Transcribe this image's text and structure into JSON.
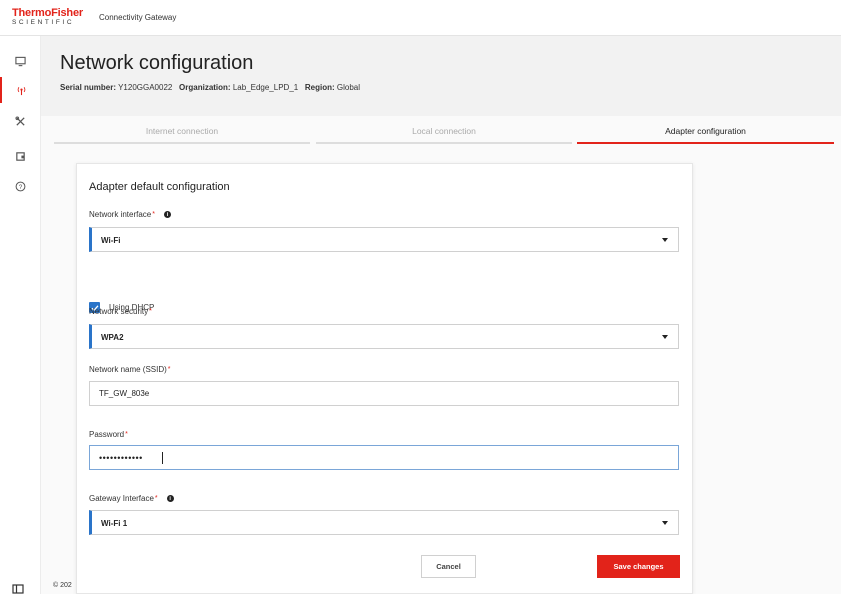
{
  "brand": {
    "logo_main": "ThermoFisher",
    "logo_sub": "SCIENTIFIC",
    "app_name": "Connectivity Gateway",
    "accent": "#e2231a",
    "focus": "#2a74c9"
  },
  "sidebar": {
    "items": [
      {
        "icon": "monitor-icon"
      },
      {
        "icon": "antenna-icon",
        "active": true
      },
      {
        "icon": "tools-icon"
      },
      {
        "icon": "device-icon"
      },
      {
        "icon": "help-icon"
      }
    ]
  },
  "page": {
    "title": "Network configuration",
    "serial_label": "Serial number:",
    "serial_value": "Y120GGA0022",
    "org_label": "Organization:",
    "org_value": "Lab_Edge_LPD_1",
    "region_label": "Region:",
    "region_value": "Global"
  },
  "tabs": [
    {
      "label": "Internet connection",
      "active": false
    },
    {
      "label": "Local connection",
      "active": false
    },
    {
      "label": "Adapter configuration",
      "active": true
    }
  ],
  "form": {
    "title": "Adapter default configuration",
    "network_interface": {
      "label": "Network interface",
      "required_mark": "*",
      "value": "Wi-Fi"
    },
    "dhcp": {
      "label": "Using DHCP",
      "checked": true
    },
    "network_security": {
      "label": "Network security",
      "required_mark": "*",
      "value": "WPA2"
    },
    "ssid": {
      "label": "Network name (SSID)",
      "required_mark": "*",
      "value": "TF_GW_803e"
    },
    "password": {
      "label": "Password",
      "required_mark": "*",
      "value": "••••••••••••"
    },
    "gateway_interface": {
      "label": "Gateway Interface",
      "required_mark": "*",
      "value": "Wi-Fi 1"
    },
    "cancel_label": "Cancel",
    "save_label": "Save changes"
  },
  "footer": {
    "text": "© 202"
  }
}
